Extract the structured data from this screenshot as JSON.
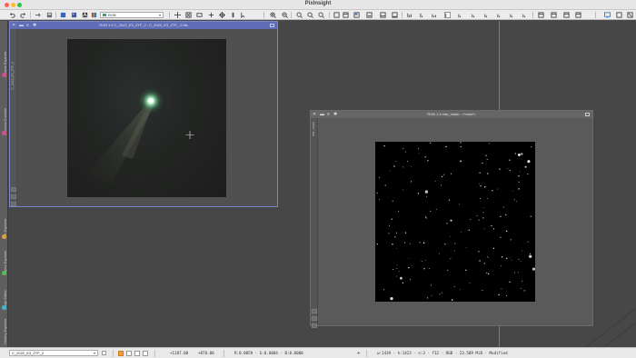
{
  "app": {
    "title": "PixInsight"
  },
  "toolbar": {
    "colorspace_select": "RGB",
    "tools": [
      "undo-icon",
      "redo-icon",
      "open-icon",
      "save-icon",
      "preview-icon",
      "new-icon",
      "stf-icon",
      "zoom-in-icon",
      "zoom-out-icon",
      "fit-icon",
      "pan-icon",
      "readout-icon",
      "hist-icon",
      "graph-icon",
      "mask-icon",
      "image-icon",
      "window-icon",
      "monitor-icon"
    ]
  },
  "left_dock": {
    "tabs": [
      {
        "label": "Format Explorer",
        "color": "#d64c8e"
      },
      {
        "label": "Process Console",
        "color": "#d64c8e"
      },
      {
        "label": "File Explorer",
        "color": "#e0a13a"
      },
      {
        "label": "Object Explorer",
        "color": "#4fbf4f"
      },
      {
        "label": "Script Editor",
        "color": "#3fb8d0"
      },
      {
        "label": "History Explorer",
        "color": "#d06a3a"
      }
    ]
  },
  "windows": [
    {
      "id": "comet",
      "title": "RGB 1:3 C_2022_E3_ZTF_2 : C_2022_E3_ZTF_-2.fits",
      "side_label": "C_2022_E3_ZTF_2",
      "active": true
    },
    {
      "id": "stars",
      "title": "RGB 1:3 star_mask : <*new*>",
      "side_label": "star_mask",
      "active": false
    }
  ],
  "statusbar": {
    "view_select": "C_2022_E3_ZTF_2",
    "coords_x": "+1187.00",
    "coords_y": "+878.00",
    "rgb_readout": "R:0.0059 · G:0.0004 · B:0.0000",
    "info": "w:1439 · h:1423 · n:3 · f32 · RGB · 23.509 MiB · Modified"
  }
}
